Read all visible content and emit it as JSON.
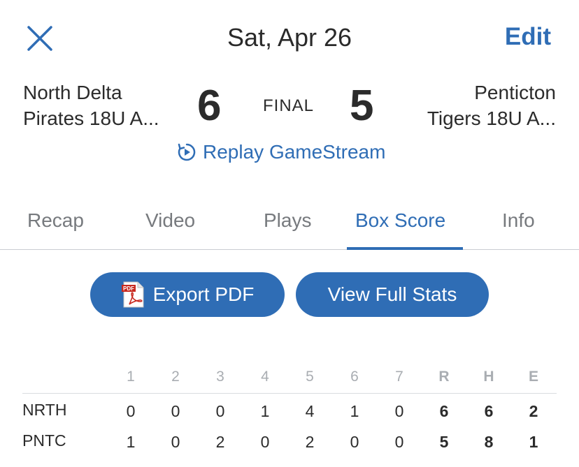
{
  "header": {
    "date": "Sat, Apr 26",
    "edit_label": "Edit",
    "close_icon": "close-icon"
  },
  "game": {
    "home_team_line1": "North Delta",
    "home_team_line2": "Pirates 18U A...",
    "home_score": "6",
    "away_team_line1": "Penticton",
    "away_team_line2": "Tigers 18U A...",
    "away_score": "5",
    "status": "FINAL",
    "replay_label": "Replay GameStream"
  },
  "tabs": [
    {
      "label": "Recap",
      "active": false
    },
    {
      "label": "Video",
      "active": false
    },
    {
      "label": "Plays",
      "active": false
    },
    {
      "label": "Box Score",
      "active": true
    },
    {
      "label": "Info",
      "active": false
    }
  ],
  "actions": {
    "export_label": "Export PDF",
    "stats_label": "View Full Stats"
  },
  "linescore": {
    "columns": [
      "1",
      "2",
      "3",
      "4",
      "5",
      "6",
      "7",
      "R",
      "H",
      "E"
    ],
    "rows": [
      {
        "team": "NRTH",
        "cells": [
          "0",
          "0",
          "0",
          "1",
          "4",
          "1",
          "0",
          "6",
          "6",
          "2"
        ]
      },
      {
        "team": "PNTC",
        "cells": [
          "1",
          "0",
          "2",
          "0",
          "2",
          "0",
          "0",
          "5",
          "8",
          "1"
        ]
      }
    ]
  },
  "colors": {
    "accent": "#2f6db5",
    "text": "#2b2b2b",
    "muted": "#777a7e"
  }
}
